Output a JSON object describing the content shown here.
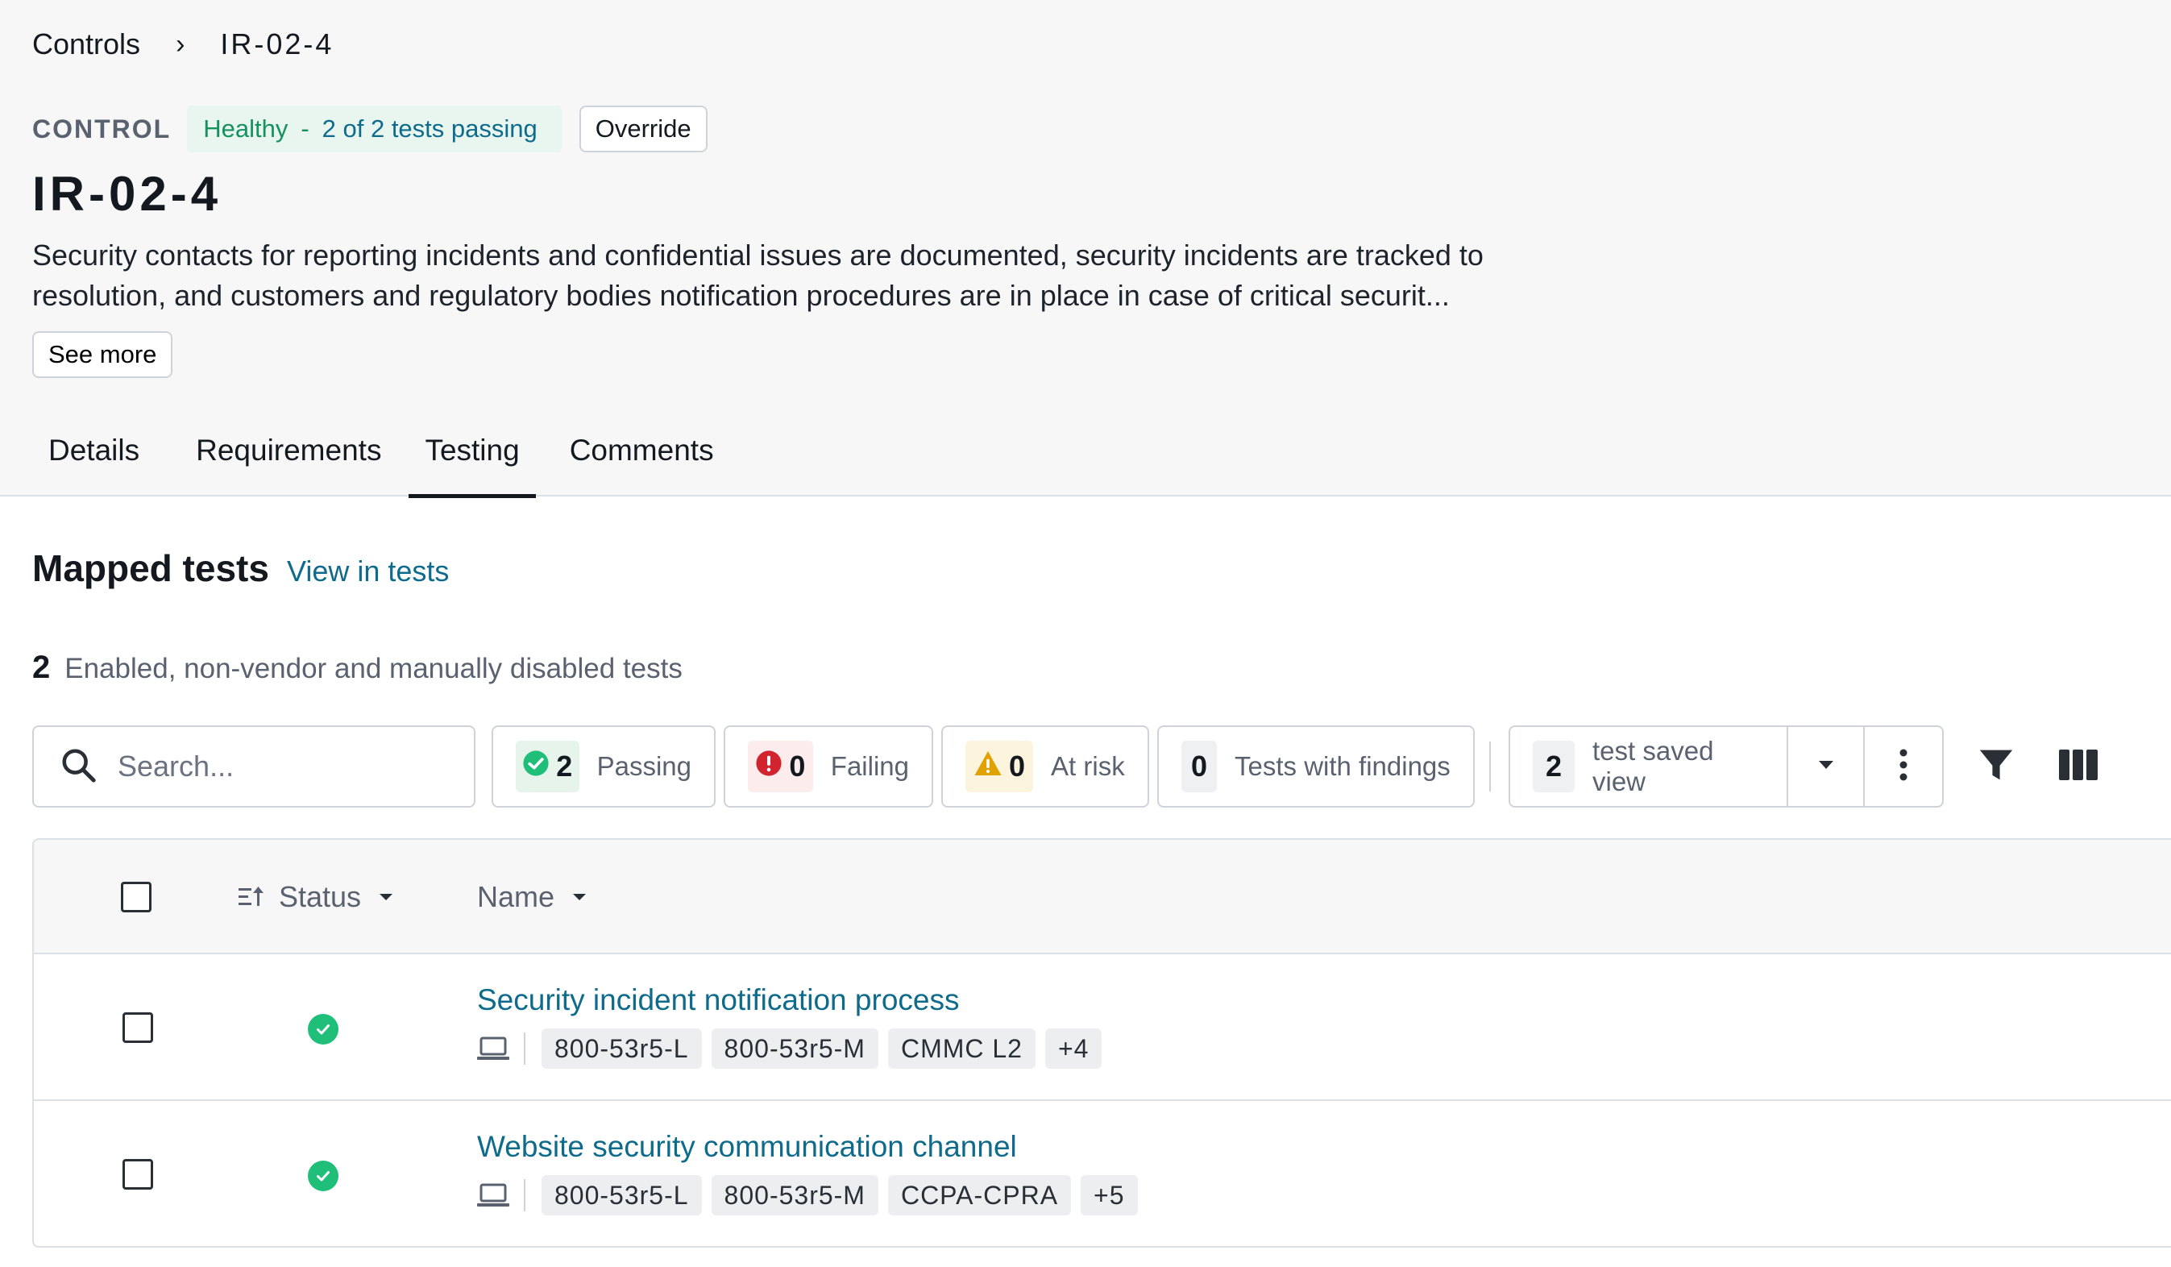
{
  "breadcrumb": {
    "parent": "Controls",
    "separator": "›",
    "current": "IR-02-4"
  },
  "control": {
    "kicker": "CONTROL",
    "health_status": "Healthy",
    "health_dash": "-",
    "health_count": "2 of 2 tests passing",
    "override_label": "Override",
    "title": "IR-02-4",
    "description": "Security contacts for reporting incidents and confidential issues are documented, security incidents are tracked to resolution, and customers and regulatory bodies notification procedures are in place in case of critical securit...",
    "see_more_label": "See more"
  },
  "tabs": [
    {
      "label": "Details",
      "active": false
    },
    {
      "label": "Requirements",
      "active": false
    },
    {
      "label": "Testing",
      "active": true
    },
    {
      "label": "Comments",
      "active": false
    }
  ],
  "section": {
    "title": "Mapped tests",
    "link": "View in tests"
  },
  "summary": {
    "count": "2",
    "text": "Enabled, non-vendor and manually disabled tests"
  },
  "toolbar": {
    "search_placeholder": "Search...",
    "passing": {
      "count": "2",
      "label": "Passing"
    },
    "failing": {
      "count": "0",
      "label": "Failing"
    },
    "at_risk": {
      "count": "0",
      "label": "At risk"
    },
    "findings": {
      "count": "0",
      "label": "Tests with findings"
    },
    "saved_view": {
      "count": "2",
      "label": "test saved view"
    }
  },
  "table": {
    "columns": {
      "status": "Status",
      "name": "Name"
    },
    "rows": [
      {
        "name": "Security incident notification process",
        "status": "passing",
        "tags": [
          "800-53r5-L",
          "800-53r5-M",
          "CMMC L2",
          "+4"
        ]
      },
      {
        "name": "Website security communication channel",
        "status": "passing",
        "tags": [
          "800-53r5-L",
          "800-53r5-M",
          "CCPA-CPRA",
          "+5"
        ]
      }
    ]
  },
  "colors": {
    "accent_link": "#0f6b8c",
    "healthy_green": "#16915f",
    "passing_green": "#1fbf7a",
    "failing_red": "#d1242f",
    "risk_amber": "#e0a200"
  }
}
